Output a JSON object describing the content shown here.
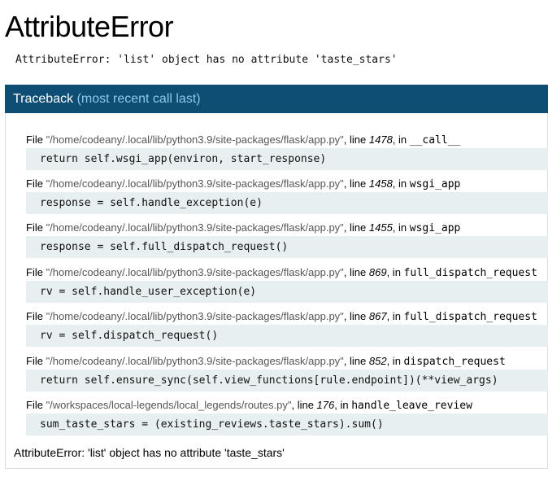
{
  "page": {
    "title": "AttributeError",
    "error_message": "AttributeError: 'list' object has no attribute 'taste_stars'"
  },
  "traceback": {
    "header": "Traceback",
    "header_sub": "(most recent call last)",
    "frames": [
      {
        "file_prefix": "File ",
        "file": "\"/home/codeany/.local/lib/python3.9/site-packages/flask/app.py\"",
        "line_label": ", line ",
        "line": "1478",
        "in_label": ", in ",
        "func": "__call__",
        "code": "return self.wsgi_app(environ, start_response)"
      },
      {
        "file_prefix": "File ",
        "file": "\"/home/codeany/.local/lib/python3.9/site-packages/flask/app.py\"",
        "line_label": ", line ",
        "line": "1458",
        "in_label": ", in ",
        "func": "wsgi_app",
        "code": "response = self.handle_exception(e)"
      },
      {
        "file_prefix": "File ",
        "file": "\"/home/codeany/.local/lib/python3.9/site-packages/flask/app.py\"",
        "line_label": ", line ",
        "line": "1455",
        "in_label": ", in ",
        "func": "wsgi_app",
        "code": "response = self.full_dispatch_request()"
      },
      {
        "file_prefix": "File ",
        "file": "\"/home/codeany/.local/lib/python3.9/site-packages/flask/app.py\"",
        "line_label": ", line ",
        "line": "869",
        "in_label": ", in ",
        "func": "full_dispatch_request",
        "code": "rv = self.handle_user_exception(e)"
      },
      {
        "file_prefix": "File ",
        "file": "\"/home/codeany/.local/lib/python3.9/site-packages/flask/app.py\"",
        "line_label": ", line ",
        "line": "867",
        "in_label": ", in ",
        "func": "full_dispatch_request",
        "code": "rv = self.dispatch_request()"
      },
      {
        "file_prefix": "File ",
        "file": "\"/home/codeany/.local/lib/python3.9/site-packages/flask/app.py\"",
        "line_label": ", line ",
        "line": "852",
        "in_label": ", in ",
        "func": "dispatch_request",
        "code": "return self.ensure_sync(self.view_functions[rule.endpoint])(**view_args)"
      },
      {
        "file_prefix": "File ",
        "file": "\"/workspaces/local-legends/local_legends/routes.py\"",
        "line_label": ", line ",
        "line": "176",
        "in_label": ", in ",
        "func": "handle_leave_review",
        "code": "sum_taste_stars = (existing_reviews.taste_stars).sum()"
      }
    ],
    "final_message": "AttributeError: 'list' object has no attribute 'taste_stars'"
  },
  "colors": {
    "header_bg": "#0e4d74",
    "header_sub": "#8ec9ea",
    "code_bg": "#e8eff0"
  }
}
